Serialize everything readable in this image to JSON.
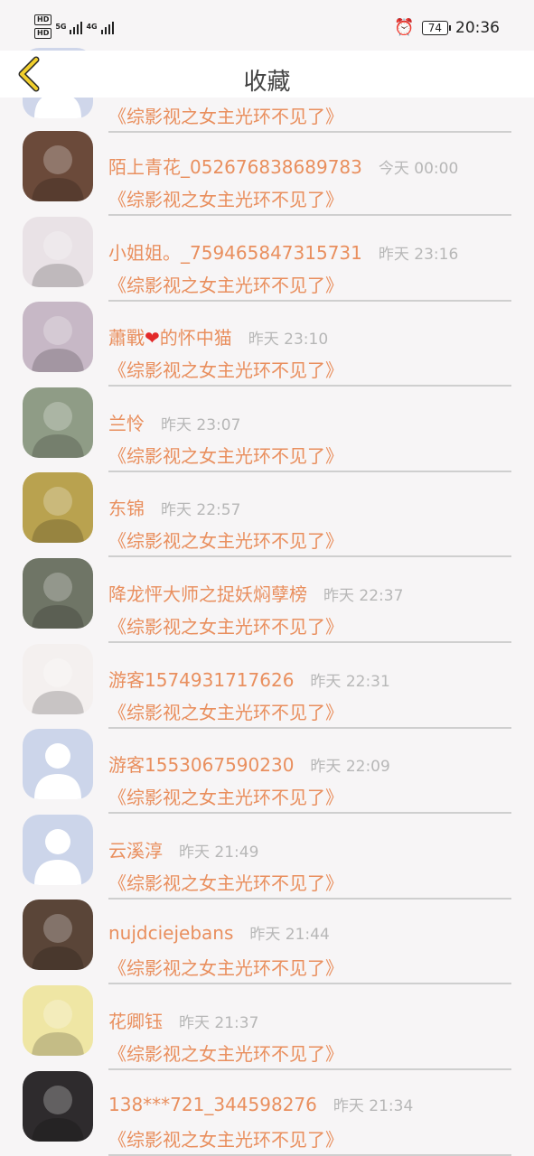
{
  "status_bar": {
    "hd1": "HD",
    "hd2": "HD",
    "net1": "5G",
    "net2": "4G",
    "battery": "74",
    "time": "20:36"
  },
  "header": {
    "title": "收藏"
  },
  "book_title": "《综影视之女主光环不见了》",
  "items": [
    {
      "name": "",
      "time": "",
      "avatar_color": "#cfd6ea"
    },
    {
      "name": "陌上青花_052676838689783",
      "time": "今天 00:00",
      "avatar_color": "#6b4a3a"
    },
    {
      "name": "小姐姐。_759465847315731",
      "time": "昨天 23:16",
      "avatar_color": "#e9e2e6"
    },
    {
      "name": "蕭戰",
      "name_heart": "❤",
      "name_suffix": "的怀中猫",
      "time": "昨天 23:10",
      "avatar_color": "#c7b8c6"
    },
    {
      "name": "兰怜",
      "time": "昨天 23:07",
      "avatar_color": "#8f9c86"
    },
    {
      "name": "东锦",
      "time": "昨天 22:57",
      "avatar_color": "#b9a24f"
    },
    {
      "name": "降龙怦大师之捉妖焖孽榜",
      "time": "昨天 22:37",
      "avatar_color": "#6f7566"
    },
    {
      "name": "游客1574931717626",
      "time": "昨天 22:31",
      "avatar_color": "#f4f0ef"
    },
    {
      "name": "游客1553067590230",
      "time": "昨天 22:09",
      "avatar_color": "#ccd5ea"
    },
    {
      "name": "云溪淳",
      "time": "昨天 21:49",
      "avatar_color": "#ccd5ea"
    },
    {
      "name": "nujdciejebans",
      "time": "昨天 21:44",
      "avatar_color": "#5a4538"
    },
    {
      "name": "花卿钰",
      "time": "昨天 21:37",
      "avatar_color": "#efe6a4"
    },
    {
      "name": "138***721_344598276",
      "time": "昨天 21:34",
      "avatar_color": "#2e2b2d"
    }
  ],
  "colors": {
    "accent": "#e98f5e",
    "time": "#b7b7b7",
    "back_arrow": "#f1cf2d"
  }
}
